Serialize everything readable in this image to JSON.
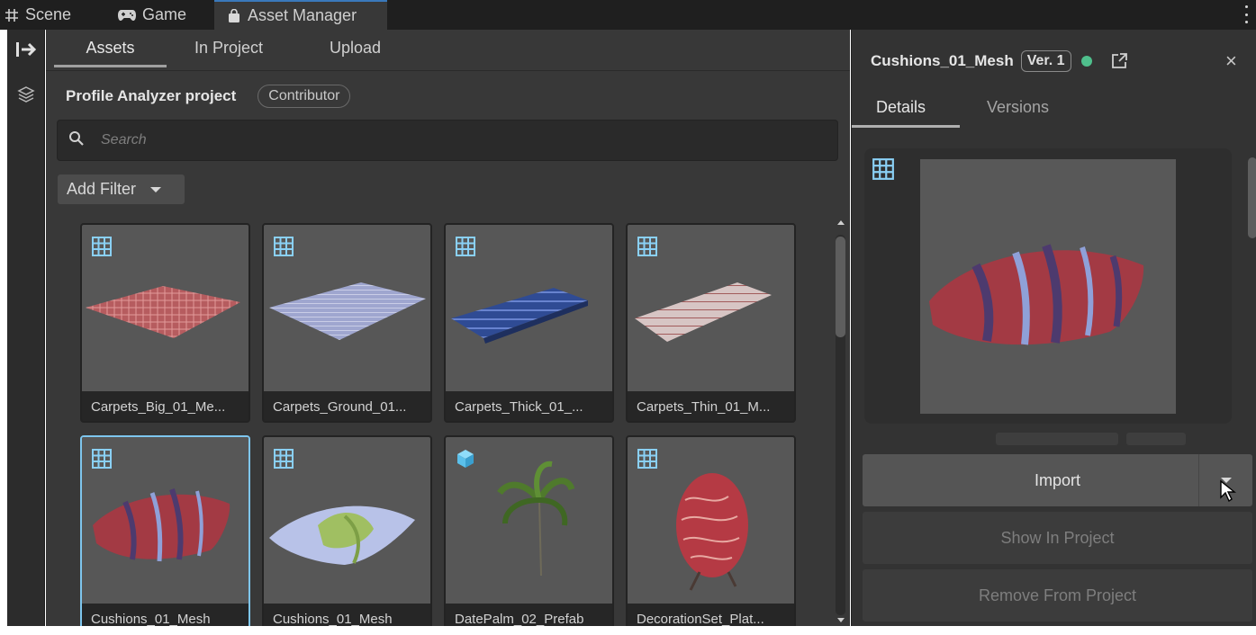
{
  "editor_tabs": [
    {
      "label": "Scene",
      "icon": "grid-icon"
    },
    {
      "label": "Game",
      "icon": "gamepad-icon"
    },
    {
      "label": "Asset Manager",
      "icon": "bag-icon"
    }
  ],
  "left_toolbar": [
    {
      "icon": "collapse-arrow-icon"
    },
    {
      "icon": "layers-icon"
    }
  ],
  "browser": {
    "tabs": [
      "Assets",
      "In Project",
      "Upload"
    ],
    "active_tab": "Assets",
    "project_name": "Profile Analyzer project",
    "role": "Contributor",
    "search": {
      "placeholder": "Search",
      "value": ""
    },
    "add_filter_label": "Add Filter"
  },
  "assets": [
    {
      "name": "Carpets_Big_01_Me...",
      "type": "mesh",
      "selected": false
    },
    {
      "name": "Carpets_Ground_01...",
      "type": "mesh",
      "selected": false
    },
    {
      "name": "Carpets_Thick_01_...",
      "type": "mesh",
      "selected": false
    },
    {
      "name": "Carpets_Thin_01_M...",
      "type": "mesh",
      "selected": false
    },
    {
      "name": "Cushions_01_Mesh",
      "type": "mesh",
      "selected": true
    },
    {
      "name": "Cushions_01_Mesh",
      "type": "mesh",
      "selected": false
    },
    {
      "name": "DatePalm_02_Prefab",
      "type": "prefab",
      "selected": false
    },
    {
      "name": "DecorationSet_Plat...",
      "type": "mesh",
      "selected": false
    }
  ],
  "detail": {
    "asset_name": "Cushions_01_Mesh",
    "version": "Ver. 1",
    "status_color": "#4fbf8c",
    "close_label": "×",
    "tabs": [
      "Details",
      "Versions"
    ],
    "active_tab": "Details",
    "import_label": "Import",
    "show_in_project_label": "Show In Project",
    "remove_from_project_label": "Remove From Project"
  },
  "colors": {
    "selection_outline": "#7ec6ee",
    "mesh_icon": "#8ad0f5",
    "prefab_icon": "#5bc0eb"
  }
}
